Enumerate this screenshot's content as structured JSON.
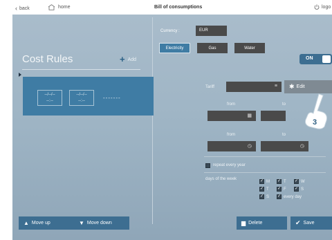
{
  "topbar": {
    "back_label": "back",
    "home_label": "home",
    "title": "Bill of consumptions",
    "logout_label": "logo"
  },
  "left": {
    "heading": "Cost Rules",
    "add_label": "Add",
    "rule": {
      "date_from": "--/--/--",
      "time_from": "--:--",
      "date_to": "--/--/--",
      "time_to": "--:--",
      "dots": "-------"
    },
    "move_up_label": "Move up",
    "move_down_label": "Move down"
  },
  "right": {
    "currency_label": "Currency :",
    "currency_value": "EUR",
    "tabs": [
      {
        "label": "Electricity",
        "active": true
      },
      {
        "label": "Gas",
        "active": false
      },
      {
        "label": "Water",
        "active": false
      }
    ],
    "toggle_label": "ON",
    "tariff_label": "Tariff",
    "edit_label": "Edit",
    "step_badge": "3",
    "from_label": "from",
    "to_label": "to",
    "repeat_label": "repeat every year",
    "days_label": "days of the week",
    "days": [
      {
        "label": "M",
        "checked": true
      },
      {
        "label": "T",
        "checked": true
      },
      {
        "label": "W",
        "checked": true
      },
      {
        "label": "T",
        "checked": true
      },
      {
        "label": "F",
        "checked": true
      },
      {
        "label": "S",
        "checked": true
      },
      {
        "label": "S",
        "checked": true
      },
      {
        "label": "every day",
        "checked": true
      }
    ],
    "delete_label": "Delete",
    "save_label": "Save"
  },
  "colors": {
    "accent": "#3d6e91",
    "card": "#3f7ca4",
    "field": "#4a4a4a",
    "panel": "#a9bccb"
  }
}
